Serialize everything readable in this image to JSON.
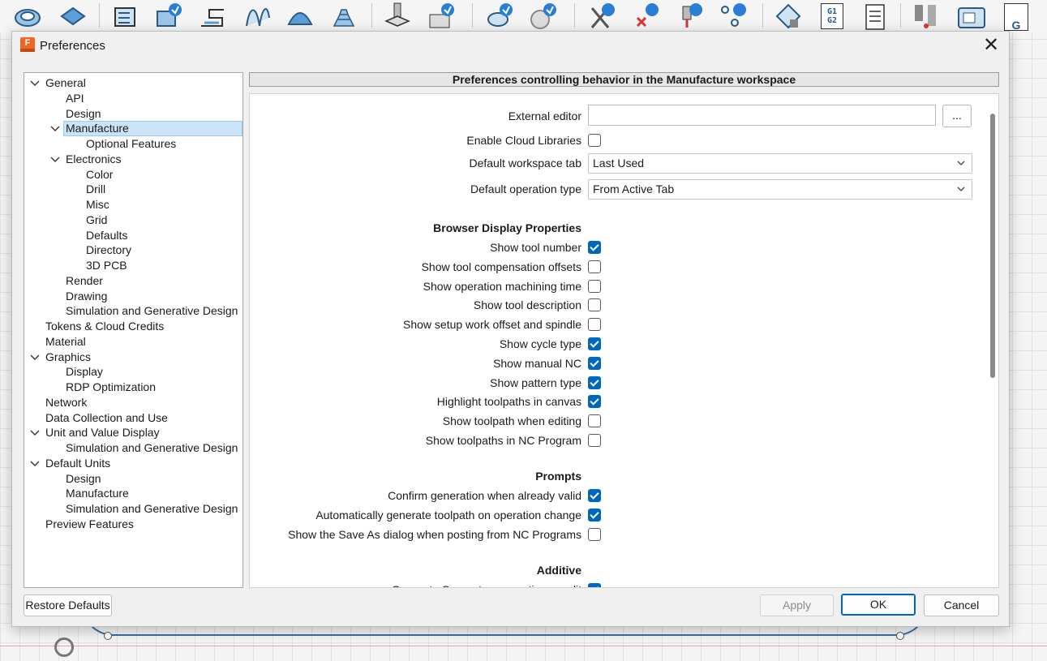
{
  "dialog": {
    "title": "Preferences",
    "logo_letter": "F"
  },
  "tree": [
    {
      "label": "General",
      "level": 0,
      "expanded": true
    },
    {
      "label": "API",
      "level": 1
    },
    {
      "label": "Design",
      "level": 1
    },
    {
      "label": "Manufacture",
      "level": 1,
      "expanded": true,
      "selected": true
    },
    {
      "label": "Optional Features",
      "level": 2
    },
    {
      "label": "Electronics",
      "level": 1,
      "expanded": true
    },
    {
      "label": "Color",
      "level": 2
    },
    {
      "label": "Drill",
      "level": 2
    },
    {
      "label": "Misc",
      "level": 2
    },
    {
      "label": "Grid",
      "level": 2
    },
    {
      "label": "Defaults",
      "level": 2
    },
    {
      "label": "Directory",
      "level": 2
    },
    {
      "label": "3D PCB",
      "level": 2
    },
    {
      "label": "Render",
      "level": 1
    },
    {
      "label": "Drawing",
      "level": 1
    },
    {
      "label": "Simulation and Generative Design",
      "level": 1
    },
    {
      "label": "Tokens & Cloud Credits",
      "level": 0
    },
    {
      "label": "Material",
      "level": 0
    },
    {
      "label": "Graphics",
      "level": 0,
      "expanded": true
    },
    {
      "label": "Display",
      "level": 1
    },
    {
      "label": "RDP Optimization",
      "level": 1
    },
    {
      "label": "Network",
      "level": 0
    },
    {
      "label": "Data Collection and Use",
      "level": 0
    },
    {
      "label": "Unit and Value Display",
      "level": 0,
      "expanded": true
    },
    {
      "label": "Simulation and Generative Design",
      "level": 1
    },
    {
      "label": "Default Units",
      "level": 0,
      "expanded": true
    },
    {
      "label": "Design",
      "level": 1
    },
    {
      "label": "Manufacture",
      "level": 1
    },
    {
      "label": "Simulation and Generative Design",
      "level": 1
    },
    {
      "label": "Preview Features",
      "level": 0
    }
  ],
  "panel": {
    "header": "Preferences controlling behavior in the Manufacture workspace",
    "external_editor_label": "External editor",
    "external_editor_value": "",
    "ellipsis_label": "...",
    "enable_cloud_label": "Enable Cloud Libraries",
    "enable_cloud_checked": false,
    "workspace_tab_label": "Default workspace tab",
    "workspace_tab_value": "Last Used",
    "operation_type_label": "Default operation type",
    "operation_type_value": "From Active Tab",
    "browser_section": "Browser Display Properties",
    "browser_items": [
      {
        "label": "Show tool number",
        "checked": true
      },
      {
        "label": "Show tool compensation offsets",
        "checked": false
      },
      {
        "label": "Show operation machining time",
        "checked": false
      },
      {
        "label": "Show tool description",
        "checked": false
      },
      {
        "label": "Show setup work offset and spindle",
        "checked": false
      },
      {
        "label": "Show cycle type",
        "checked": true
      },
      {
        "label": "Show manual NC",
        "checked": true
      },
      {
        "label": "Show pattern type",
        "checked": true
      },
      {
        "label": "Highlight toolpaths in canvas",
        "checked": true
      },
      {
        "label": "Show toolpath when editing",
        "checked": false
      },
      {
        "label": "Show toolpaths in NC Program",
        "checked": false
      }
    ],
    "prompts_section": "Prompts",
    "prompt_items": [
      {
        "label": "Confirm generation when already valid",
        "checked": true
      },
      {
        "label": "Automatically generate toolpath on operation change",
        "checked": true
      },
      {
        "label": "Show the Save As dialog when posting from NC Programs",
        "checked": false
      }
    ],
    "additive_section": "Additive",
    "additive_items": [
      {
        "label": "Generate Supports on creation or edit",
        "checked": true
      }
    ]
  },
  "footer": {
    "restore_label": "Restore Defaults",
    "apply_label": "Apply",
    "ok_label": "OK",
    "cancel_label": "Cancel"
  },
  "toolbar": {
    "icons": [
      "setup-icon",
      "stock-icon",
      "face-icon",
      "adaptive-clearing-icon",
      "contour-2d-icon",
      "slot-icon",
      "flow-icon",
      "pocket-icon",
      "spiral-icon",
      "drill-icon",
      "hole-recognition-icon",
      "probe-icon",
      "tool-library-icon",
      "simulate-icon",
      "generate-icon",
      "clear-icon",
      "post-process-icon",
      "nc-program-icon",
      "g-code-icon",
      "setup-sheet-icon",
      "machine-builder-icon",
      "machine-icon",
      "post-library-icon"
    ],
    "g_code_text": "G1 G2",
    "g_text": "G"
  }
}
